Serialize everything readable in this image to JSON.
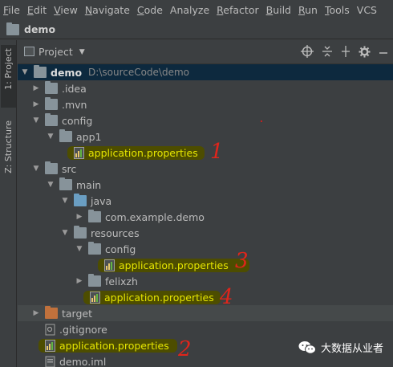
{
  "menu": [
    {
      "u": "F",
      "rest": "ile"
    },
    {
      "u": "E",
      "rest": "dit"
    },
    {
      "u": "V",
      "rest": "iew"
    },
    {
      "u": "N",
      "rest": "avigate"
    },
    {
      "u": "C",
      "rest": "ode"
    },
    {
      "u": "",
      "rest": "Analyze"
    },
    {
      "u": "R",
      "rest": "efactor"
    },
    {
      "u": "B",
      "rest": "uild"
    },
    {
      "u": "R",
      "rest": "un"
    },
    {
      "u": "T",
      "rest": "ools"
    },
    {
      "u": "",
      "rest": "VCS"
    }
  ],
  "navbar": {
    "label": "demo"
  },
  "toolstrip": {
    "project_tab": "1: Project",
    "structure_tab": "Z: Structure"
  },
  "panel": {
    "title": "Project"
  },
  "tree": [
    {
      "label": "demo",
      "path": "D:\\sourceCode\\demo"
    },
    {
      "label": ".idea"
    },
    {
      "label": ".mvn"
    },
    {
      "label": "config"
    },
    {
      "label": "app1"
    },
    {
      "label": "application.properties"
    },
    {
      "label": "src"
    },
    {
      "label": "main"
    },
    {
      "label": "java"
    },
    {
      "label": "com.example.demo"
    },
    {
      "label": "resources"
    },
    {
      "label": "config"
    },
    {
      "label": "application.properties"
    },
    {
      "label": "felixzh"
    },
    {
      "label": "application.properties"
    },
    {
      "label": "target"
    },
    {
      "label": ".gitignore"
    },
    {
      "label": "application.properties"
    },
    {
      "label": "demo.iml"
    }
  ],
  "annotations": [
    "1",
    "2",
    "3",
    "4"
  ],
  "watermark": "大数据从业者"
}
